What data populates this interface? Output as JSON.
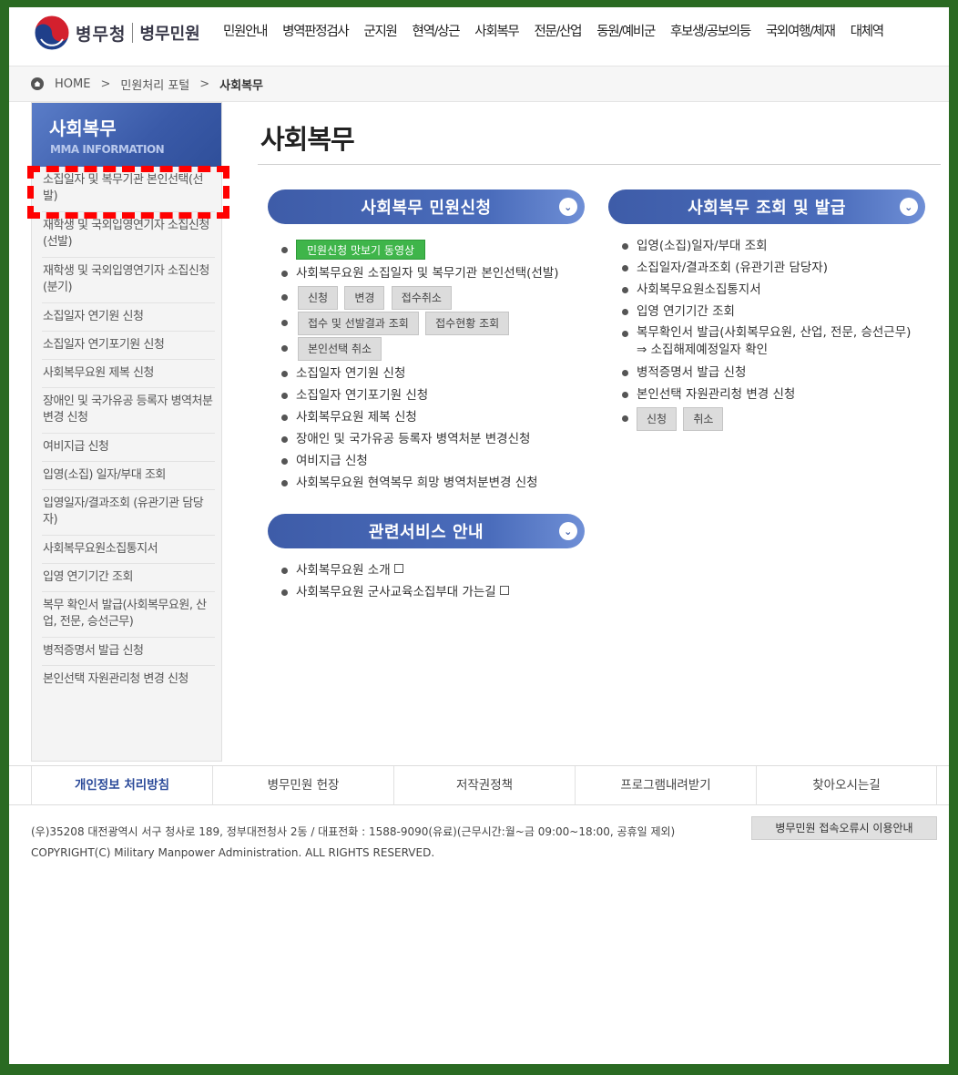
{
  "header": {
    "org": "병무청",
    "service": "병무민원",
    "nav": [
      "민원안내",
      "병역판정검사",
      "군지원",
      "현역/상근",
      "사회복무",
      "전문/산업",
      "동원/예비군",
      "후보생/공보의등",
      "국외여행/체재",
      "대체역"
    ]
  },
  "breadcrumb": {
    "home": "HOME",
    "portal": "민원처리 포털",
    "current": "사회복무"
  },
  "sidebar": {
    "title": "사회복무",
    "subtitle": "MMA INFORMATION",
    "items": [
      "소집일자 및 복무기관 본인선택(선발)",
      "재학생 및 국외입영연기자 소집신청(선발)",
      "재학생 및 국외입영연기자 소집신청(분기)",
      "소집일자 연기원 신청",
      "소집일자 연기포기원 신청",
      "사회복무요원 제복 신청",
      "장애인 및 국가유공 등록자 병역처분변경 신청",
      "여비지급 신청",
      "입영(소집) 일자/부대 조회",
      "입영일자/결과조회 (유관기관 담당자)",
      "사회복무요원소집통지서",
      "입영 연기기간 조회",
      "복무 확인서 발급(사회복무요원, 산업, 전문, 승선근무)",
      "병적증명서 발급 신청",
      "본인선택 자원관리청 변경 신청"
    ]
  },
  "main": {
    "title": "사회복무",
    "section1": {
      "title": "사회복무 민원신청",
      "video_button": "민원신청 맛보기 동영상",
      "item1": "사회복무요원 소집일자 및 복무기관 본인선택(선발)",
      "buttons_row1": [
        "신청",
        "변경",
        "접수취소"
      ],
      "buttons_row2": [
        "접수 및 선발결과 조회",
        "접수현황 조회"
      ],
      "buttons_row3": [
        "본인선택 취소"
      ],
      "items": [
        "소집일자 연기원 신청",
        "소집일자 연기포기원 신청",
        "사회복무요원 제복 신청",
        "장애인 및 국가유공 등록자 병역처분 변경신청",
        "여비지급 신청",
        "사회복무요원 현역복무 희망 병역처분변경 신청"
      ]
    },
    "section2": {
      "title": "관련서비스 안내",
      "items": [
        "사회복무요원 소개",
        "사회복무요원 군사교육소집부대 가는길"
      ]
    },
    "section3": {
      "title": "사회복무 조회 및 발급",
      "items": [
        "입영(소집)일자/부대 조회",
        "소집일자/결과조회 (유관기관 담당자)",
        "사회복무요원소집통지서",
        "입영 연기기간 조회",
        "복무확인서 발급(사회복무요원, 산업, 전문, 승선근무)"
      ],
      "item5_sub": "⇒ 소집해제예정일자 확인",
      "items_after": [
        "병적증명서 발급 신청",
        "본인선택 자원관리청 변경 신청"
      ],
      "buttons": [
        "신청",
        "취소"
      ]
    }
  },
  "footer": {
    "links": [
      "개인정보 처리방침",
      "병무민원 헌장",
      "저작권정책",
      "프로그램내려받기",
      "찾아오시는길"
    ],
    "address": "(우)35208 대전광역시 서구 청사로 189, 정부대전청사 2동 / 대표전화 : 1588-9090(유료)(근무시간:월~금 09:00~18:00, 공휴일 제외)",
    "copyright": "COPYRIGHT(C) Military Manpower Administration. ALL RIGHTS RESERVED.",
    "help_button": "병무민원 접속오류시 이용안내"
  },
  "colors": {
    "frame": "#2a6a22",
    "accent": "#3e5ca8",
    "green_button": "#3fb54a",
    "highlight": "#ff0000"
  }
}
